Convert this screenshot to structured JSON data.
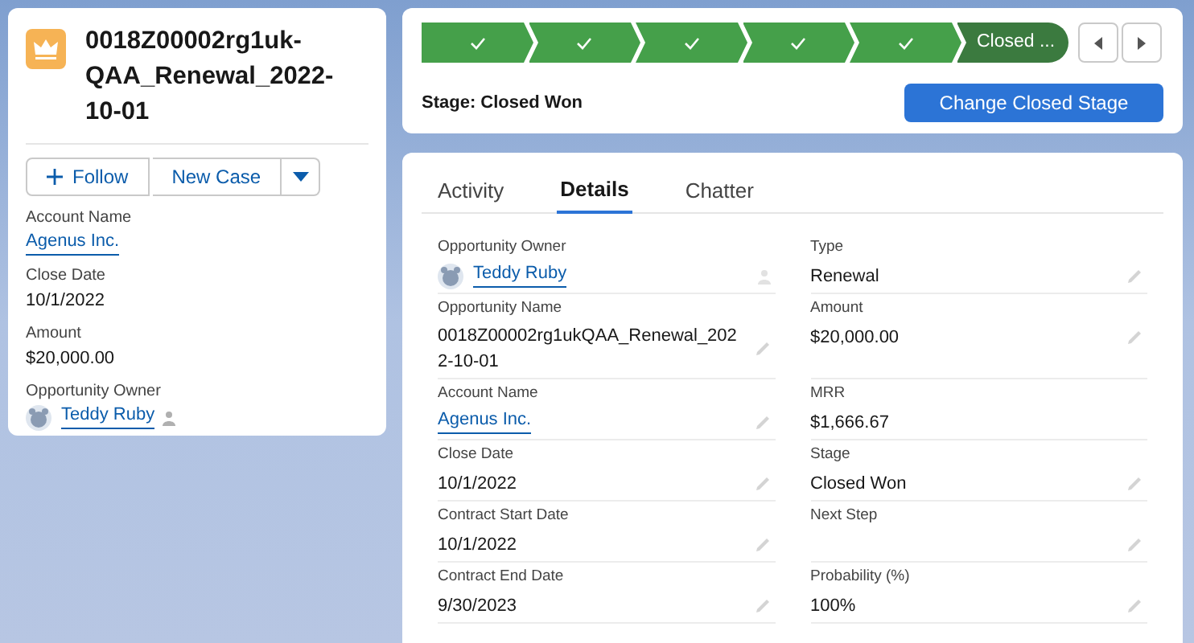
{
  "record": {
    "title": "0018Z00002rg1uk-QAA_Renewal_2022-10-01"
  },
  "actions": [
    {
      "label": "Follow",
      "kind": "follow"
    },
    {
      "label": "New Case",
      "kind": "plain"
    },
    {
      "kind": "menu"
    }
  ],
  "highlights": [
    {
      "label": "Account Name",
      "value": "Agenus Inc.",
      "kind": "link"
    },
    {
      "label": "Close Date",
      "value": "10/1/2022",
      "kind": "text"
    },
    {
      "label": "Amount",
      "value": "$20,000.00",
      "kind": "text"
    },
    {
      "label": "Opportunity Owner",
      "value": "Teddy Ruby",
      "kind": "owner"
    }
  ],
  "path": {
    "steps": [
      {
        "kind": "complete"
      },
      {
        "kind": "complete"
      },
      {
        "kind": "complete"
      },
      {
        "kind": "complete"
      },
      {
        "kind": "complete"
      },
      {
        "label": "Closed ...",
        "kind": "current"
      }
    ],
    "stage_text": "Stage: Closed Won",
    "button": "Change Closed Stage"
  },
  "tabs": [
    {
      "label": "Activity",
      "selected": false
    },
    {
      "label": "Details",
      "selected": true
    },
    {
      "label": "Chatter",
      "selected": false
    }
  ],
  "details": [
    {
      "label": "Opportunity Owner",
      "value": "Teddy Ruby",
      "kind": "owner",
      "editable": true
    },
    {
      "label": "Type",
      "value": "Renewal",
      "kind": "text",
      "editable": true
    },
    {
      "label": "Opportunity Name",
      "value": "0018Z00002rg1ukQAA_Renewal_2022-10-01",
      "kind": "text",
      "editable": true
    },
    {
      "label": "Amount",
      "value": "$20,000.00",
      "kind": "text",
      "editable": true
    },
    {
      "label": "Account Name",
      "value": "Agenus Inc.",
      "kind": "link",
      "editable": true
    },
    {
      "label": "MRR",
      "value": "$1,666.67",
      "kind": "text",
      "editable": false
    },
    {
      "label": "Close Date",
      "value": "10/1/2022",
      "kind": "text",
      "editable": true
    },
    {
      "label": "Stage",
      "value": "Closed Won",
      "kind": "text",
      "editable": true
    },
    {
      "label": "Contract Start Date",
      "value": "10/1/2022",
      "kind": "text",
      "editable": true
    },
    {
      "label": "Next Step",
      "kind": "text",
      "editable": true
    },
    {
      "label": "Contract End Date",
      "value": "9/30/2023",
      "kind": "text",
      "editable": true
    },
    {
      "label": "Probability (%)",
      "value": "100%",
      "kind": "text",
      "editable": true
    }
  ]
}
